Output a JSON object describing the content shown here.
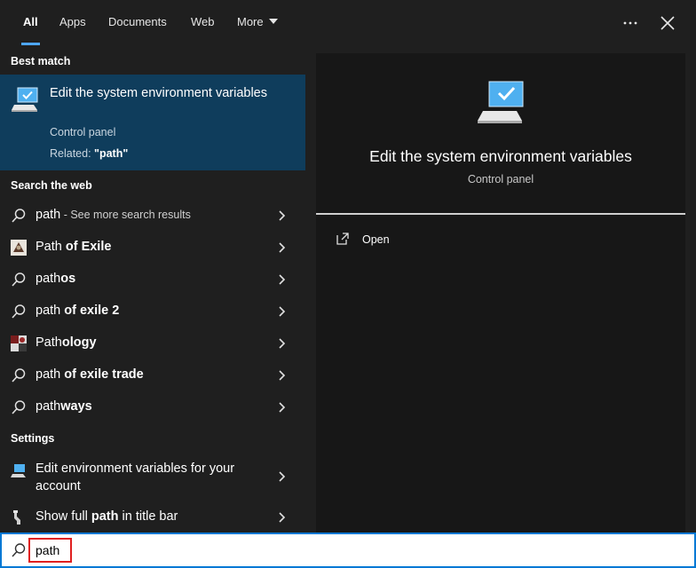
{
  "tabs": [
    {
      "label": "All"
    },
    {
      "label": "Apps"
    },
    {
      "label": "Documents"
    },
    {
      "label": "Web"
    },
    {
      "label": "More"
    }
  ],
  "best_match": {
    "heading": "Best match",
    "title": "Edit the system environment variables",
    "subtitle": "Control panel",
    "related_prefix": "Related: ",
    "related_value": "\"path\""
  },
  "search_web": {
    "heading": "Search the web",
    "items": [
      {
        "prefix": "path",
        "bold": "",
        "small": " - See more search results",
        "icon": "search-icon"
      },
      {
        "prefix": "Path ",
        "bold": "of Exile",
        "small": "",
        "icon": "image-thumbnail-icon"
      },
      {
        "prefix": "path",
        "bold": "os",
        "small": "",
        "icon": "search-icon"
      },
      {
        "prefix": "path ",
        "bold": "of exile 2",
        "small": "",
        "icon": "search-icon"
      },
      {
        "prefix": "Path",
        "bold": "ology",
        "small": "",
        "icon": "image-thumbnail-icon"
      },
      {
        "prefix": "path ",
        "bold": "of exile trade",
        "small": "",
        "icon": "search-icon"
      },
      {
        "prefix": "path",
        "bold": "ways",
        "small": "",
        "icon": "search-icon"
      }
    ]
  },
  "settings": {
    "heading": "Settings",
    "items": [
      {
        "prefix": "Edit environment variables for your account",
        "bold": "",
        "suffix": "",
        "icon": "monitor-settings-icon"
      },
      {
        "prefix": "Show full ",
        "bold": "path",
        "suffix": " in title bar",
        "icon": "wrench-icon"
      }
    ]
  },
  "detail": {
    "title": "Edit the system environment variables",
    "subtitle": "Control panel",
    "action_open": "Open"
  },
  "search": {
    "value": "path"
  },
  "colors": {
    "accent": "#0078d4",
    "selected_bg": "#0f3d5c",
    "highlight_border": "#e02020"
  }
}
